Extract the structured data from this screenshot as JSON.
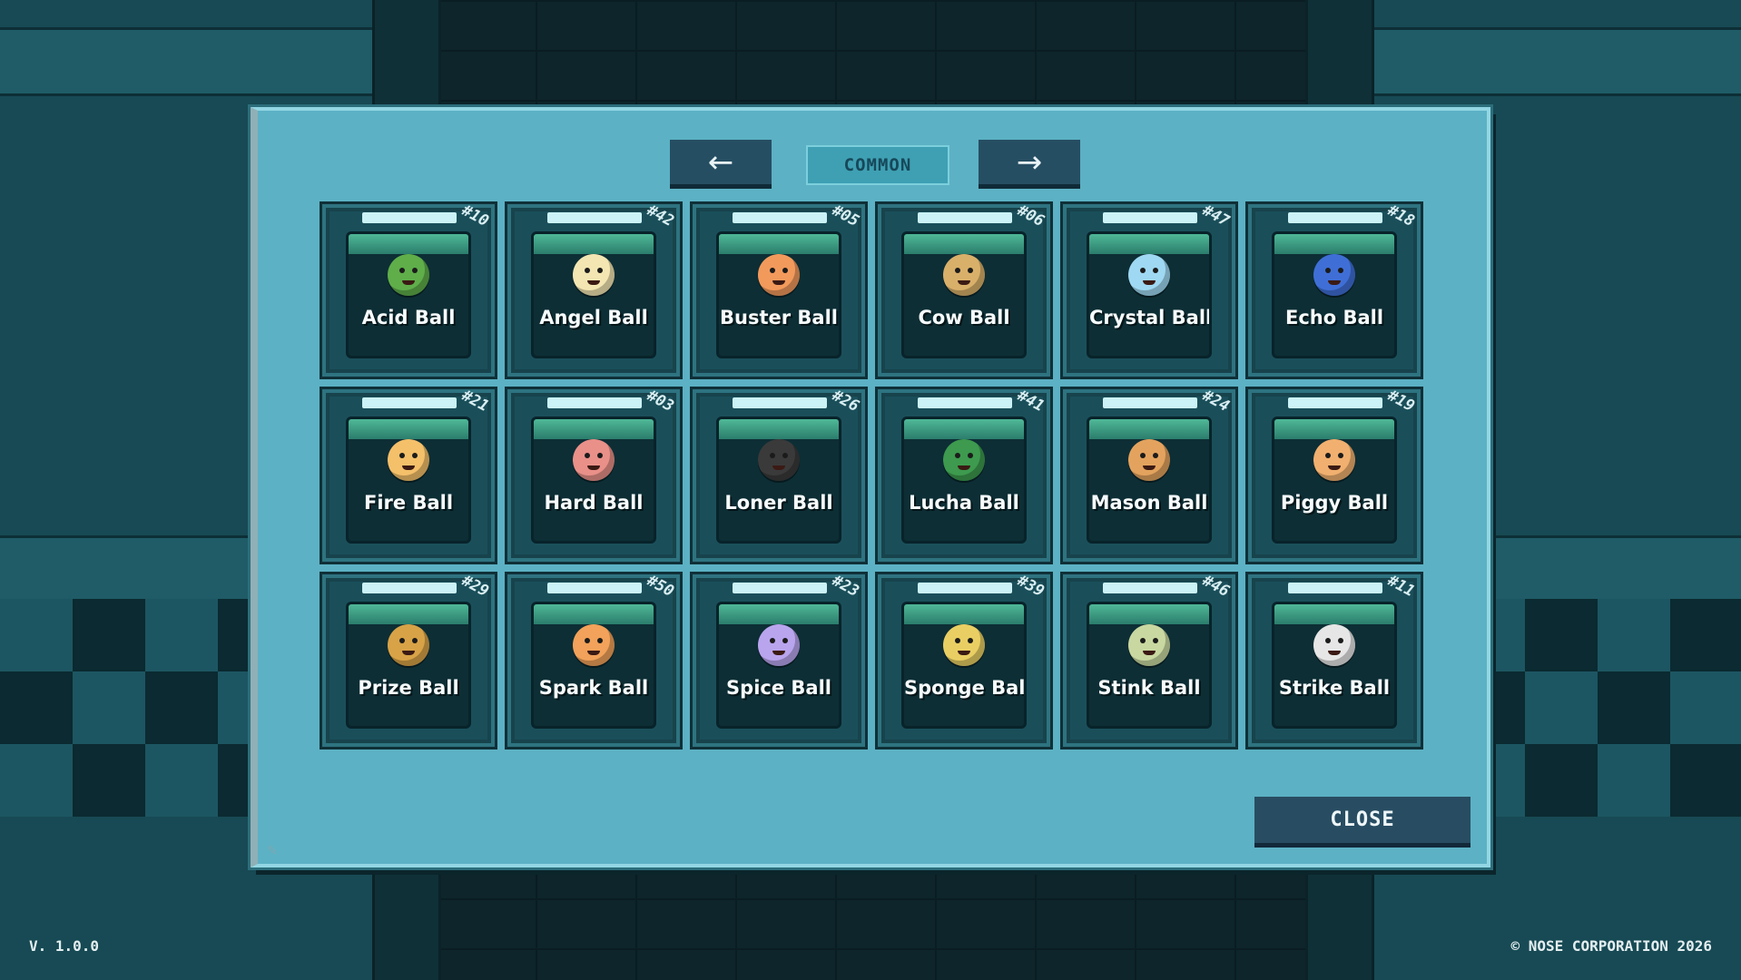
{
  "nav": {
    "prev_icon": "arrow-left-icon",
    "prev_glyph": "←",
    "next_icon": "arrow-right-icon",
    "next_glyph": "→",
    "rarity_label": "COMMON"
  },
  "cards": [
    {
      "name": "Acid Ball",
      "number": "#10",
      "color": "#5fae4a"
    },
    {
      "name": "Angel Ball",
      "number": "#42",
      "color": "#f3e6b2"
    },
    {
      "name": "Buster Ball",
      "number": "#05",
      "color": "#f29a5c"
    },
    {
      "name": "Cow Ball",
      "number": "#06",
      "color": "#d9b06a"
    },
    {
      "name": "Crystal Ball",
      "number": "#47",
      "color": "#9fd8f2"
    },
    {
      "name": "Echo Ball",
      "number": "#18",
      "color": "#3f6fd6"
    },
    {
      "name": "Fire Ball",
      "number": "#21",
      "color": "#f4c06a"
    },
    {
      "name": "Hard Ball",
      "number": "#03",
      "color": "#e99089"
    },
    {
      "name": "Loner Ball",
      "number": "#26",
      "color": "#3a3a3a"
    },
    {
      "name": "Lucha Ball",
      "number": "#41",
      "color": "#3d9a4e"
    },
    {
      "name": "Mason Ball",
      "number": "#24",
      "color": "#e3a35e"
    },
    {
      "name": "Piggy Ball",
      "number": "#19",
      "color": "#f1b06f"
    },
    {
      "name": "Prize Ball",
      "number": "#29",
      "color": "#d8a347"
    },
    {
      "name": "Spark Ball",
      "number": "#50",
      "color": "#f2a25a"
    },
    {
      "name": "Spice Ball",
      "number": "#23",
      "color": "#b9a5ee"
    },
    {
      "name": "Sponge Ball",
      "number": "#39",
      "color": "#e9cf63"
    },
    {
      "name": "Stink Ball",
      "number": "#46",
      "color": "#c9d8a1"
    },
    {
      "name": "Strike Ball",
      "number": "#11",
      "color": "#e6e6e6"
    }
  ],
  "close_label": "CLOSE",
  "footer": {
    "version": "V. 1.0.0",
    "copyright": "© NOSE CORPORATION 2026"
  }
}
